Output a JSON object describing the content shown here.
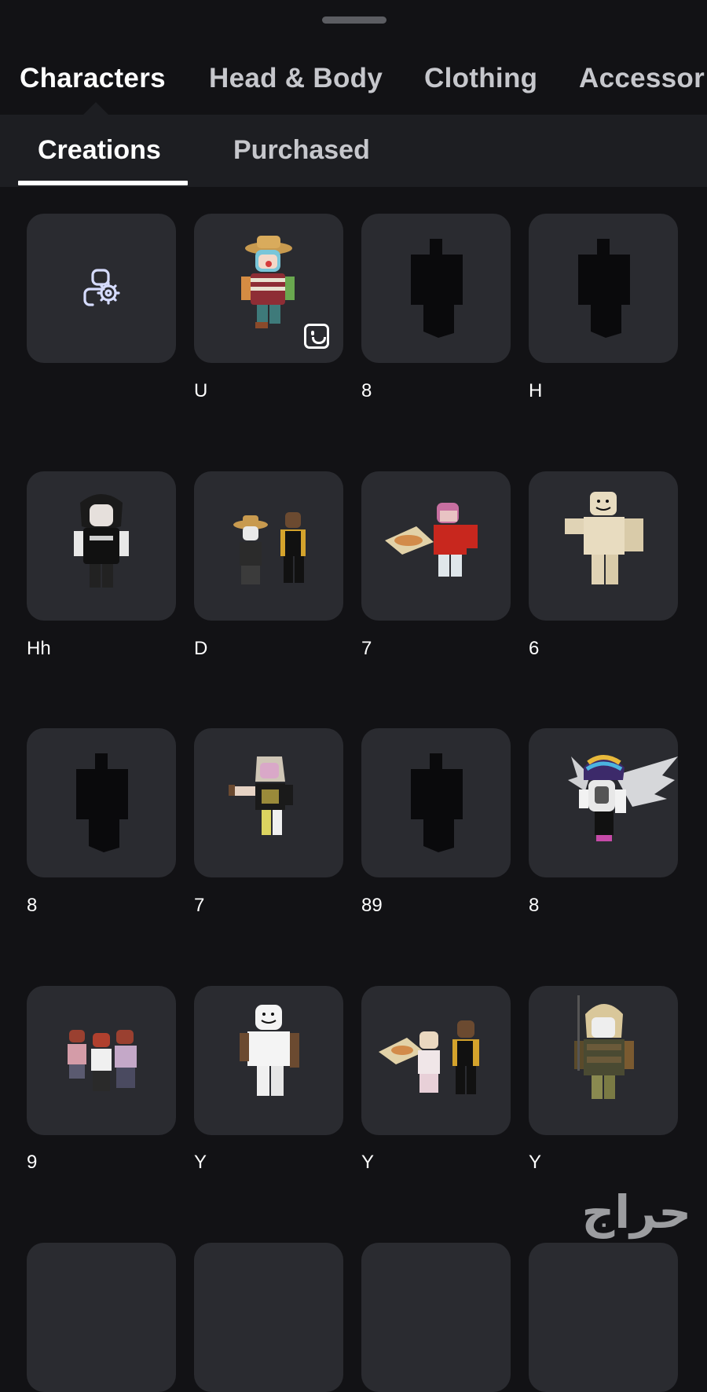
{
  "nav": {
    "top_tabs": [
      {
        "label": "Characters",
        "active": true
      },
      {
        "label": "Head & Body",
        "active": false
      },
      {
        "label": "Clothing",
        "active": false
      },
      {
        "label": "Accessor",
        "active": false
      }
    ],
    "sub_tabs": [
      {
        "label": "Creations",
        "active": true
      },
      {
        "label": "Purchased",
        "active": false
      }
    ]
  },
  "create_tile": {
    "icon": "character-settings-icon"
  },
  "characters": [
    {
      "name": "U",
      "thumb": "straw-hat-clown",
      "badge": "emote-icon"
    },
    {
      "name": "8",
      "thumb": "placeholder-silhouette"
    },
    {
      "name": "H",
      "thumb": "placeholder-silhouette"
    },
    {
      "name": "Hh",
      "thumb": "black-shirt-avatar"
    },
    {
      "name": "D",
      "thumb": "duo-avatars"
    },
    {
      "name": "7",
      "thumb": "pizza-avatar"
    },
    {
      "name": "6",
      "thumb": "blocky-noob"
    },
    {
      "name": "8",
      "thumb": "placeholder-silhouette"
    },
    {
      "name": "7",
      "thumb": "emo-avatar"
    },
    {
      "name": "89",
      "thumb": "placeholder-silhouette"
    },
    {
      "name": "8",
      "thumb": "winged-avatar"
    },
    {
      "name": "9",
      "thumb": "trio-avatars"
    },
    {
      "name": "Y",
      "thumb": "white-blocky"
    },
    {
      "name": "Y",
      "thumb": "pizza-duo"
    },
    {
      "name": "Y",
      "thumb": "soldier-avatar"
    }
  ],
  "watermark": "حراج",
  "colors": {
    "background": "#121215",
    "subnav": "#1d1e22",
    "tile": "#2a2b30",
    "text": "#ffffff",
    "muted": "#c6c7cc"
  }
}
